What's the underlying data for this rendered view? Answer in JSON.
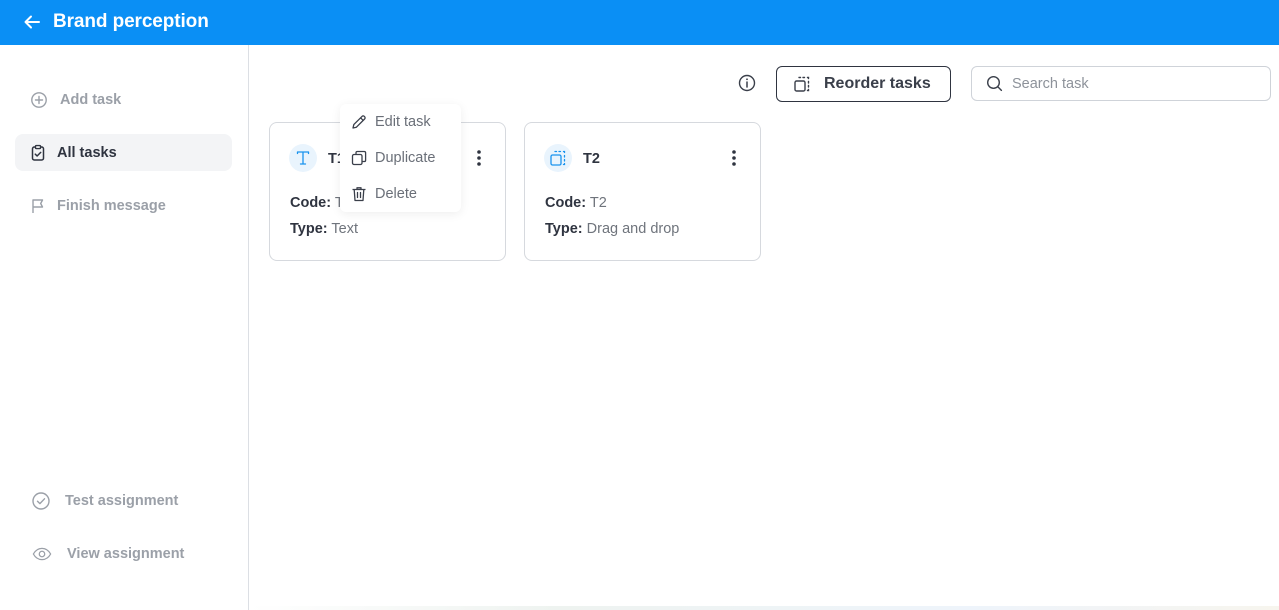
{
  "header": {
    "title": "Brand perception",
    "back_icon": "arrow-left-icon",
    "background": "#0a8ff5"
  },
  "sidebar": {
    "items": [
      {
        "label": "Add task",
        "icon": "plus-circle-icon",
        "active": false
      },
      {
        "label": "All tasks",
        "icon": "clipboard-check-icon",
        "active": true
      },
      {
        "label": "Finish message",
        "icon": "flag-icon",
        "active": false
      }
    ],
    "bottom_items": [
      {
        "label": "Test assignment",
        "icon": "check-circle-icon"
      },
      {
        "label": "View assignment",
        "icon": "eye-icon"
      }
    ]
  },
  "toolbar": {
    "info_icon": "info-icon",
    "reorder_label": "Reorder tasks",
    "search_placeholder": "Search task",
    "search_value": ""
  },
  "tasks": [
    {
      "title": "T1",
      "icon": "text-type-icon",
      "code_label": "Code:",
      "code_value": "T1",
      "type_label": "Type:",
      "type_value": "Text"
    },
    {
      "title": "T2",
      "icon": "drag-drop-icon",
      "code_label": "Code:",
      "code_value": "T2",
      "type_label": "Type:",
      "type_value": "Drag and drop"
    }
  ],
  "context_menu": {
    "items": [
      {
        "label": "Edit task",
        "icon": "pencil-icon"
      },
      {
        "label": "Duplicate",
        "icon": "copy-icon"
      },
      {
        "label": "Delete",
        "icon": "trash-icon"
      }
    ]
  },
  "colors": {
    "accent": "#0a8ff5",
    "text": "#2f3440",
    "muted": "#9ba0a8"
  }
}
